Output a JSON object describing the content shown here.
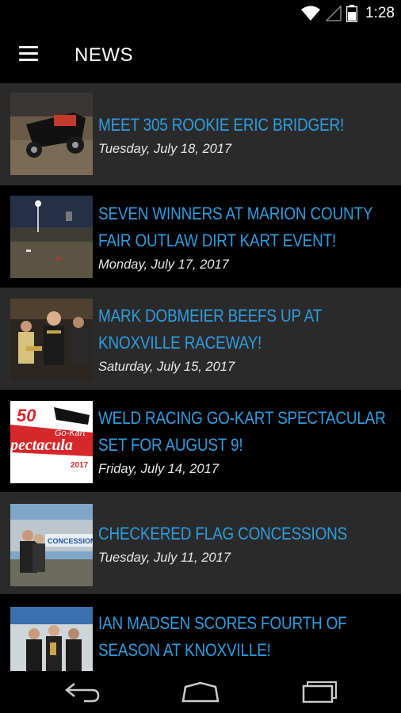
{
  "status_bar": {
    "time": "1:28"
  },
  "app_bar": {
    "title": "NEWS"
  },
  "news": [
    {
      "headline": "MEET 305 ROOKIE ERIC BRIDGER!",
      "date": "Tuesday, July 18, 2017"
    },
    {
      "headline": "SEVEN WINNERS AT MARION COUNTY FAIR OUTLAW DIRT KART EVENT!",
      "date": "Monday, July 17, 2017"
    },
    {
      "headline": "MARK DOBMEIER BEEFS UP AT KNOXVILLE RACEWAY!",
      "date": "Saturday, July 15, 2017"
    },
    {
      "headline": "WELD RACING GO-KART SPECTACULAR SET FOR AUGUST 9!",
      "date": "Friday, July 14, 2017"
    },
    {
      "headline": "CHECKERED FLAG CONCESSIONS",
      "date": "Tuesday, July 11, 2017"
    },
    {
      "headline": "IAN MADSEN SCORES FOURTH OF SEASON AT KNOXVILLE!",
      "date": ""
    }
  ],
  "thumb_text": {
    "weld_number": "50",
    "weld_sub": "Go-Kart",
    "weld_main": "pectacula",
    "weld_year": "2017",
    "concession": "CONCESSION"
  },
  "colors": {
    "accent": "#2e9de0",
    "row_gray": "#2a2a2a",
    "row_black": "#000000"
  },
  "icons": [
    "wifi-icon",
    "signal-icon",
    "battery-icon",
    "menu-icon",
    "back-icon",
    "home-icon",
    "recents-icon"
  ]
}
